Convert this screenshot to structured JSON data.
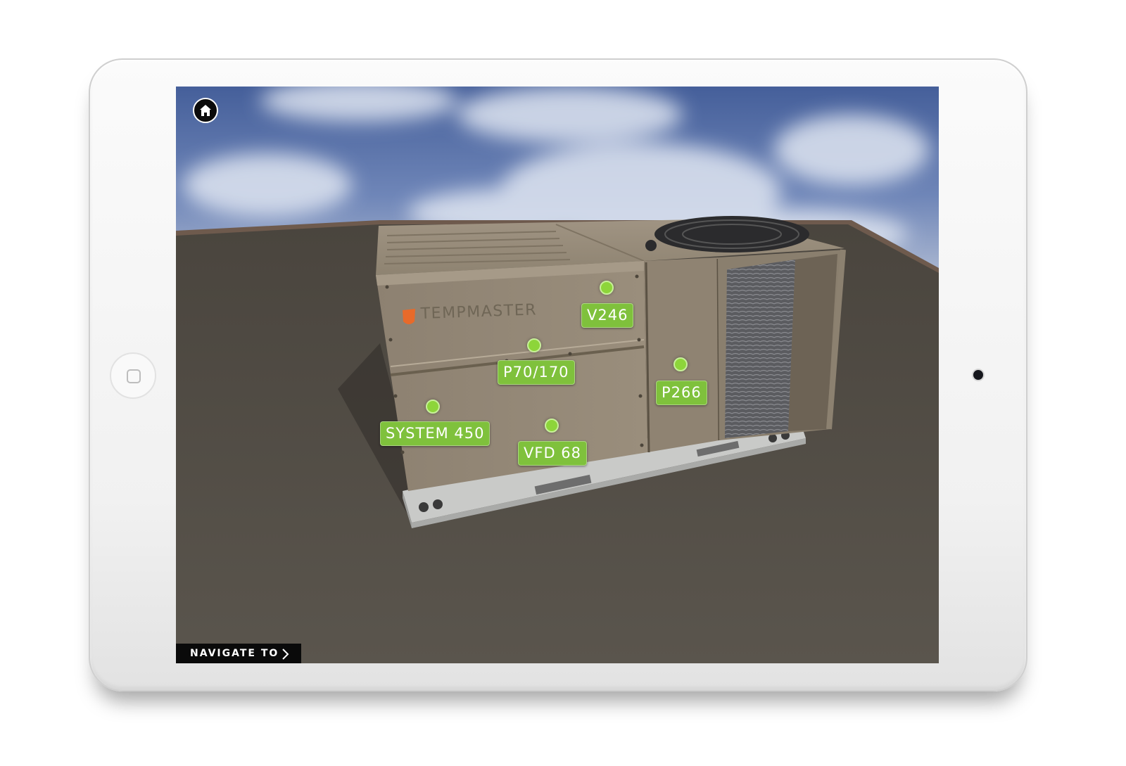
{
  "brand": {
    "logo_text": "TEMPMASTER",
    "accent_color": "#e86a2a"
  },
  "toolbar": {
    "home_icon": "home-icon"
  },
  "navigation": {
    "label": "NAVIGATE TO",
    "icon": "chevron-right-icon"
  },
  "hotspots": [
    {
      "id": "v246",
      "label": "V246"
    },
    {
      "id": "p70-170",
      "label": "P70/170"
    },
    {
      "id": "p266",
      "label": "P266"
    },
    {
      "id": "system-450",
      "label": "SYSTEM 450"
    },
    {
      "id": "vfd-68",
      "label": "VFD 68"
    }
  ],
  "colors": {
    "hotspot": "#7fc13c",
    "hotspot_dot": "#8dd53a"
  }
}
